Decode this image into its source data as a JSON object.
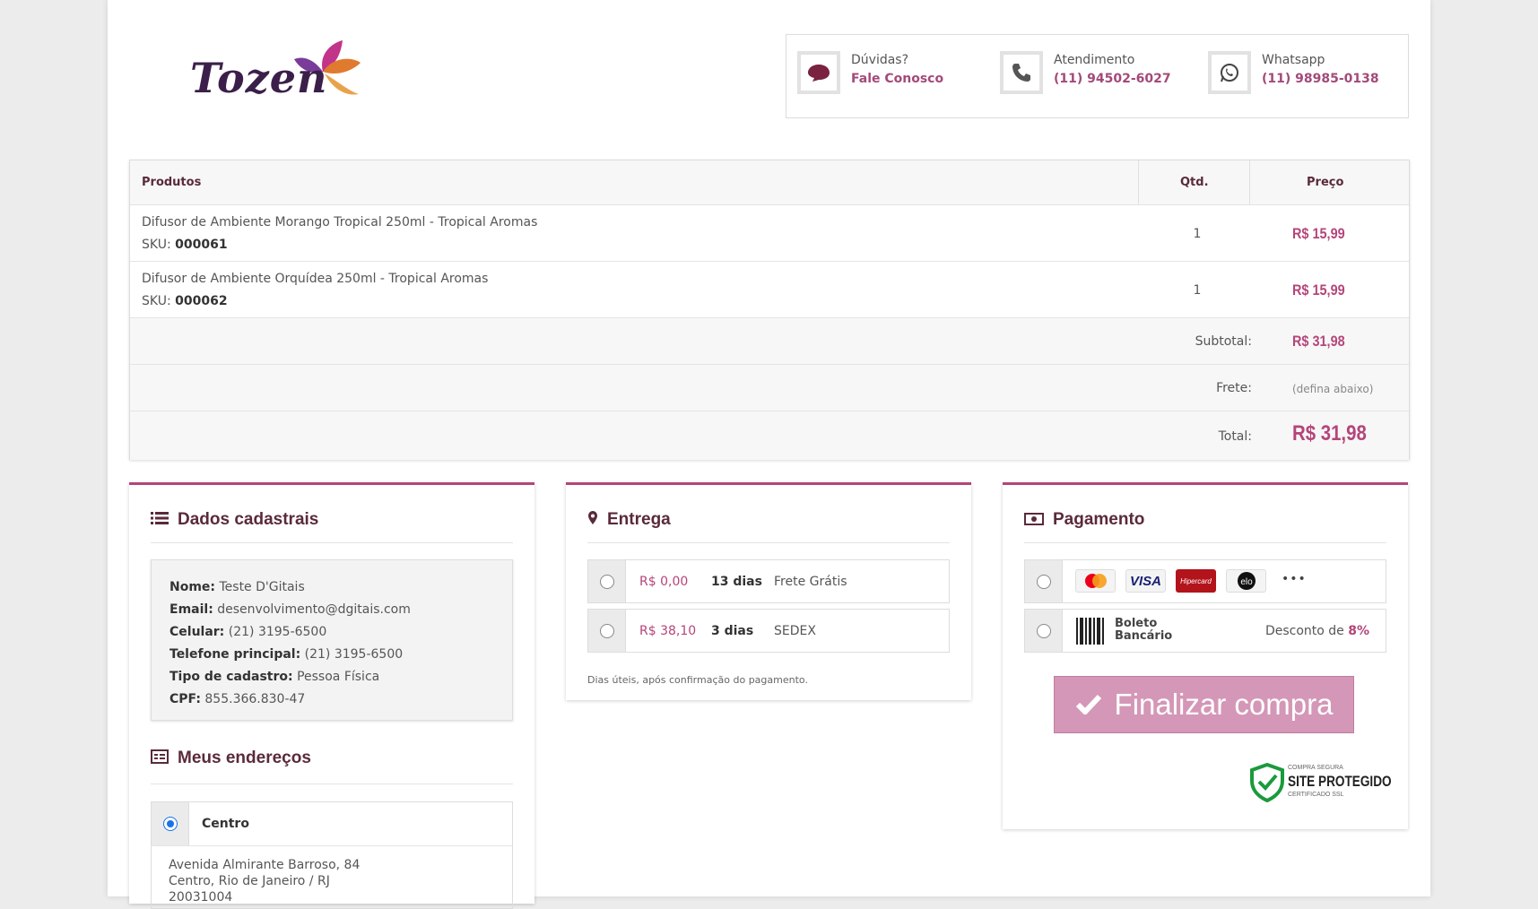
{
  "header": {
    "logo_text": "Tozen",
    "contacts": [
      {
        "icon": "chat-bubble-icon",
        "line1": "Dúvidas?",
        "line2": "Fale Conosco"
      },
      {
        "icon": "phone-icon",
        "line1": "Atendimento",
        "line2": "(11) 94502-6027"
      },
      {
        "icon": "whatsapp-icon",
        "line1": "Whatsapp",
        "line2": "(11) 98985-0138"
      }
    ]
  },
  "cart": {
    "headers": {
      "products": "Produtos",
      "qty": "Qtd.",
      "price": "Preço"
    },
    "items": [
      {
        "name": "Difusor de Ambiente Morango Tropical 250ml - Tropical Aromas",
        "sku_label": "SKU:",
        "sku": "000061",
        "qty": "1",
        "price": "R$ 15,99"
      },
      {
        "name": "Difusor de Ambiente Orquídea 250ml - Tropical Aromas",
        "sku_label": "SKU:",
        "sku": "000062",
        "qty": "1",
        "price": "R$ 15,99"
      }
    ],
    "subtotal_label": "Subtotal:",
    "subtotal": "R$ 31,98",
    "shipping_label": "Frete:",
    "shipping_hint": "(defina abaixo)",
    "total_label": "Total:",
    "total": "R$ 31,98"
  },
  "registration": {
    "title": "Dados cadastrais",
    "fields": [
      {
        "label": "Nome:",
        "value": "Teste D'Gitais"
      },
      {
        "label": "Email:",
        "value": "desenvolvimento@dgitais.com"
      },
      {
        "label": "Celular:",
        "value": "(21) 3195-6500"
      },
      {
        "label": "Telefone principal:",
        "value": "(21) 3195-6500"
      },
      {
        "label": "Tipo de cadastro:",
        "value": "Pessoa Física"
      },
      {
        "label": "CPF:",
        "value": "855.366.830-47"
      }
    ],
    "addresses_title": "Meus endereços",
    "address": {
      "name": "Centro",
      "line1": "Avenida Almirante Barroso, 84",
      "line2": "Centro, Rio de Janeiro / RJ",
      "line3": "20031004"
    }
  },
  "delivery": {
    "title": "Entrega",
    "options": [
      {
        "price": "R$ 0,00",
        "days": "13 dias",
        "service": "Frete Grátis"
      },
      {
        "price": "R$ 38,10",
        "days": "3 dias",
        "service": "SEDEX"
      }
    ],
    "note": "Dias úteis, após confirmação do pagamento."
  },
  "payment": {
    "title": "Pagamento",
    "card_brands": [
      "mastercard",
      "VISA",
      "Hipercard",
      "elo"
    ],
    "more": "•••",
    "boleto_line1": "Boleto",
    "boleto_line2": "Bancário",
    "discount_prefix": "Desconto de",
    "discount_value": "8%",
    "finalize_label": "Finalizar compra",
    "ssl_line1": "COMPRA SEGURA",
    "ssl_line2": "SITE PROTEGIDO",
    "ssl_line3": "CERTIFICADO SSL"
  },
  "colors": {
    "accent": "#b4457a",
    "title": "#5a2a3a",
    "button": "#d497b7"
  }
}
